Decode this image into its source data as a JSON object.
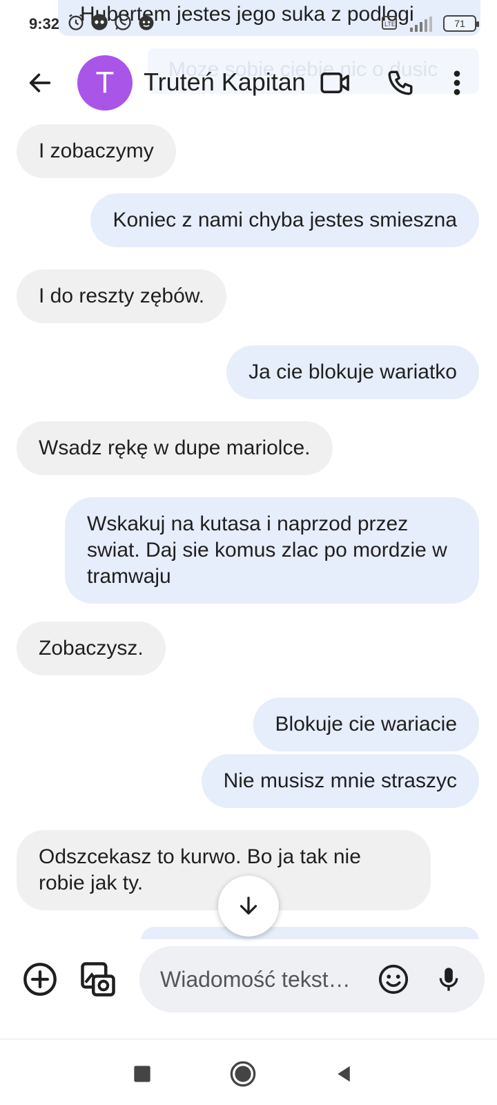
{
  "status_bar": {
    "time": "9:32",
    "battery": "71",
    "network": "LTE",
    "icons": [
      "alarm-icon",
      "messenger-icon",
      "whatsapp-icon",
      "reddit-icon",
      "lte-icon",
      "signal-icon",
      "battery-icon"
    ]
  },
  "overlay": {
    "top_ghost_text": "Hubertem jestes jego suka z podlogi",
    "mid_ghost_text": "Moze sobie ciebie nic o dusic"
  },
  "header": {
    "avatar_letter": "T",
    "contact_name": "Truteń Kapitan",
    "avatar_color": "#a855e8"
  },
  "messages": [
    {
      "direction": "in",
      "text": "I zobaczymy"
    },
    {
      "direction": "out",
      "text": "Koniec z nami chyba jestes smieszna"
    },
    {
      "direction": "in",
      "text": "I do reszty zębów."
    },
    {
      "direction": "out",
      "text": "Ja cie blokuje wariatko"
    },
    {
      "direction": "in",
      "text": "Wsadz rękę w dupe mariolce."
    },
    {
      "direction": "out",
      "text": "Wskakuj na kutasa i naprzod przez swiat. Daj sie komus zlac po mordzie w tramwaju"
    },
    {
      "direction": "in",
      "text": "Zobaczysz."
    },
    {
      "direction": "out",
      "text": "Blokuje cie wariacie"
    },
    {
      "direction": "out",
      "text": "Nie musisz mnie straszyc"
    },
    {
      "direction": "in",
      "text": "Odszcekasz to kurwo. Bo ja tak nie robie jak ty."
    }
  ],
  "composer": {
    "placeholder": "Wiadomość tekst…"
  },
  "colors": {
    "incoming_bubble": "#f0f0f0",
    "outgoing_bubble": "#e6edfb",
    "avatar": "#a855e8"
  }
}
